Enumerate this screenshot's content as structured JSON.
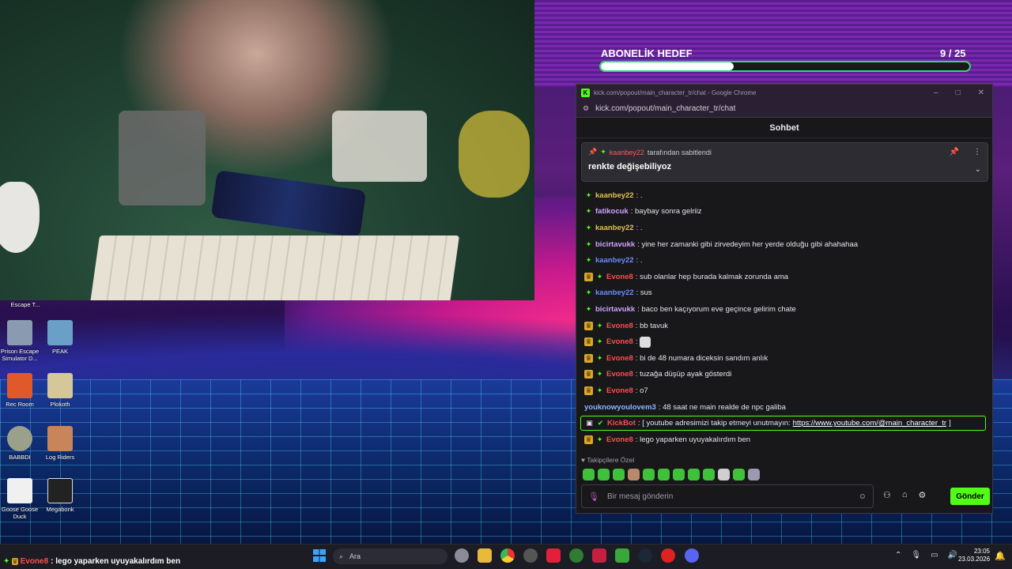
{
  "goal": {
    "title": "ABONELİK HEDEF",
    "current": 9,
    "target": 25,
    "count_text": "9  / 25",
    "progress_fraction": 0.36,
    "bar_color": "#36d67a"
  },
  "window": {
    "title": "kick.com/popout/main_character_tr/chat - Google Chrome",
    "url": "kick.com/popout/main_character_tr/chat",
    "minimize_icon": "–",
    "maximize_icon": "□",
    "close_icon": "✕"
  },
  "chat": {
    "header": "Sohbet",
    "pinned": {
      "user": "kaanbey22",
      "by_text": "tarafından sabitlendi",
      "message": "renkte değişebiliyoz"
    },
    "messages": [
      {
        "badges": [
          "gem"
        ],
        "user": "kaanbey22",
        "color": "u-yellow",
        "text": "."
      },
      {
        "badges": [
          "gem"
        ],
        "user": "fatikocuk",
        "color": "u-purple",
        "text": "baybay sonra gelriiz"
      },
      {
        "badges": [
          "gem"
        ],
        "user": "kaanbey22",
        "color": "u-yellow",
        "text": "."
      },
      {
        "badges": [
          "gem"
        ],
        "user": "bicirtavukk",
        "color": "u-purple",
        "text": "yine her zamanki gibi zirvedeyim her yerde olduğu gibi ahahahaa"
      },
      {
        "badges": [
          "gem"
        ],
        "user": "kaanbey22",
        "color": "u-blue",
        "text": "."
      },
      {
        "badges": [
          "crown",
          "gem"
        ],
        "user": "Evone8",
        "color": "u-red",
        "text": "sub olanlar hep burada kalmak zorunda ama"
      },
      {
        "badges": [
          "gem"
        ],
        "user": "kaanbey22",
        "color": "u-blue",
        "text": "sus"
      },
      {
        "badges": [
          "gem"
        ],
        "user": "bicirtavukk",
        "color": "u-purple",
        "text": "baco ben kaçıyorum eve geçince gelirim chate"
      },
      {
        "badges": [
          "crown",
          "gem"
        ],
        "user": "Evone8",
        "color": "u-red",
        "text": "bb tavuk"
      },
      {
        "badges": [
          "crown",
          "gem"
        ],
        "user": "Evone8",
        "color": "u-red",
        "text": ""
      },
      {
        "badges": [
          "crown",
          "gem"
        ],
        "user": "Evone8",
        "color": "u-red",
        "text": "bi de 48 numara diceksin sandım anlık"
      },
      {
        "badges": [
          "crown",
          "gem"
        ],
        "user": "Evone8",
        "color": "u-red",
        "text": "tuzağa düşüp ayak gösterdi"
      },
      {
        "badges": [
          "crown",
          "gem"
        ],
        "user": "Evone8",
        "color": "u-red",
        "text": "o7"
      },
      {
        "badges": [],
        "user": "youknowyoulovem3",
        "color": "u-lblue",
        "text": "48 saat ne main realde de npc galiba"
      }
    ],
    "bot": {
      "user": "KickBot",
      "prefix": "[ youtube adresimizi takip etmeyi unutmayın:",
      "link": "https://www.youtube.com/@main_character_tr",
      "suffix": "]"
    },
    "last": {
      "user": "Evone8",
      "text": "lego yaparken uyuyakalırdım ben"
    },
    "followers_label": "Takipçilere Özel",
    "input_placeholder": "Bir mesaj gönderin",
    "send_label": "Gönder"
  },
  "desktop_icons": [
    {
      "label": "Escape T..."
    },
    {
      "label": "Prison Escape Simulator D..."
    },
    {
      "label": "PEAK"
    },
    {
      "label": "Rec Room"
    },
    {
      "label": "Plokoth"
    },
    {
      "label": "BABBDI"
    },
    {
      "label": "Log Riders"
    },
    {
      "label": "Goose Goose Duck"
    },
    {
      "label": "Megabonk"
    }
  ],
  "taskbar": {
    "ticker_user": "Evone8",
    "ticker_text": ": lego yaparken uyuyakalırdım ben",
    "search_label": "Ara",
    "time": "23:05",
    "date": "23.03.2026"
  }
}
